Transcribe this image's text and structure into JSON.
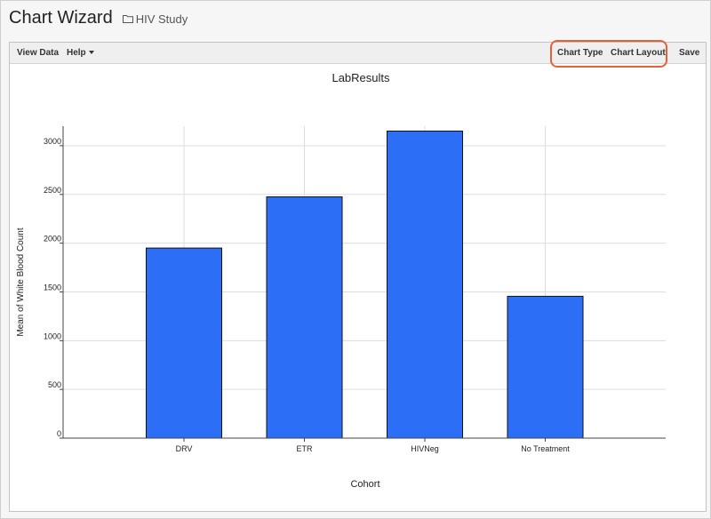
{
  "header": {
    "title": "Chart Wizard",
    "folder_label": "HIV Study"
  },
  "toolbar": {
    "view_data": "View Data",
    "help": "Help",
    "chart_type": "Chart Type",
    "chart_layout": "Chart Layout",
    "save": "Save"
  },
  "colors": {
    "bar_fill": "#2d6ef7",
    "highlight": "#e8603a"
  },
  "chart_data": {
    "type": "bar",
    "title": "LabResults",
    "xlabel": "Cohort",
    "ylabel": "Mean of White Blood Count",
    "categories": [
      "DRV",
      "ETR",
      "HIVNeg",
      "No Treatment"
    ],
    "values": [
      1950,
      2475,
      3150,
      1455
    ],
    "ylim": [
      0,
      3200
    ],
    "yticks": [
      0,
      500,
      1000,
      1500,
      2000,
      2500,
      3000
    ],
    "grid": true,
    "legend": "none"
  }
}
